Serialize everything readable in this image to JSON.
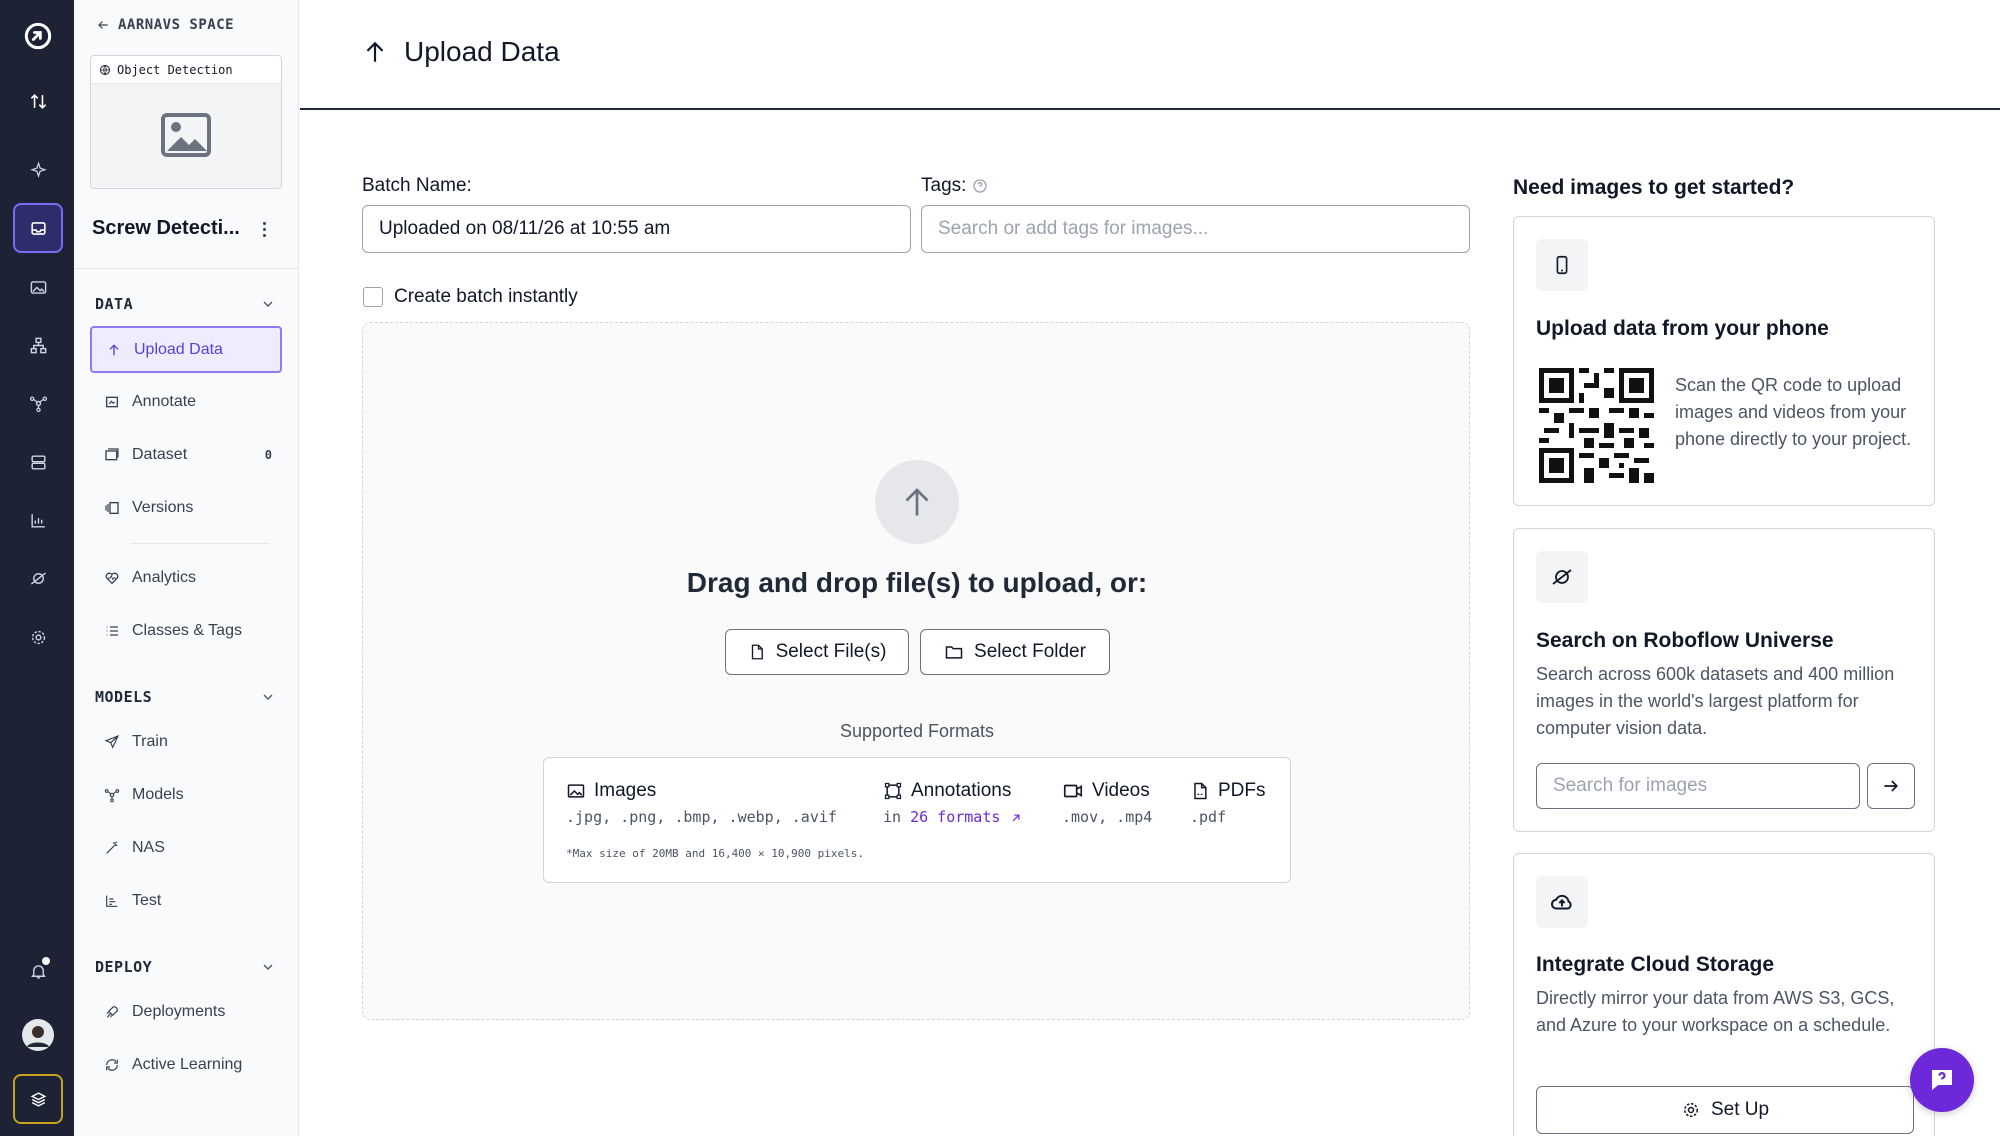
{
  "sidebar": {
    "back_label": "AARNAVS SPACE",
    "project_type": "Object Detection",
    "project_name": "Screw Detecti...",
    "sections": {
      "data": "DATA",
      "models": "MODELS",
      "deploy": "DEPLOY"
    },
    "items": {
      "upload": "Upload Data",
      "annotate": "Annotate",
      "dataset": "Dataset",
      "dataset_count": "0",
      "versions": "Versions",
      "analytics": "Analytics",
      "classes": "Classes & Tags",
      "train": "Train",
      "models": "Models",
      "nas": "NAS",
      "test": "Test",
      "deployments": "Deployments",
      "active_learning": "Active Learning"
    }
  },
  "header": {
    "title": "Upload Data"
  },
  "form": {
    "batch_label": "Batch Name:",
    "batch_value": "Uploaded on 08/11/26 at 10:55 am",
    "tags_label": "Tags:",
    "tags_placeholder": "Search or add tags for images...",
    "instant_label": "Create batch instantly"
  },
  "dropzone": {
    "title": "Drag and drop file(s) to upload, or:",
    "select_files": "Select File(s)",
    "select_folder": "Select Folder",
    "formats_label": "Supported Formats",
    "formats": {
      "images": "Images",
      "images_ext": ".jpg, .png, .bmp, .webp, .avif",
      "annotations": "Annotations",
      "annotations_prefix": "in",
      "annotations_link": "26 formats",
      "videos": "Videos",
      "videos_ext": ".mov, .mp4",
      "pdfs": "PDFs",
      "pdfs_ext": ".pdf",
      "note": "*Max size of 20MB and 16,400 × 10,900 pixels."
    }
  },
  "right": {
    "title": "Need images to get started?",
    "phone": {
      "title": "Upload data from your phone",
      "text": "Scan the QR code to upload images and videos from your phone directly to your project."
    },
    "universe": {
      "title": "Search on Roboflow Universe",
      "text": "Search across 600k datasets and 400 million images in the world's largest platform for computer vision data.",
      "placeholder": "Search for images"
    },
    "cloud": {
      "title": "Integrate Cloud Storage",
      "text": "Directly mirror your data from AWS S3, GCS, and Azure to your workspace on a schedule.",
      "button": "Set Up"
    }
  },
  "colors": {
    "rail_bg": "#1e2235",
    "accent": "#6d28d9",
    "active_border": "#8b7cf6"
  }
}
